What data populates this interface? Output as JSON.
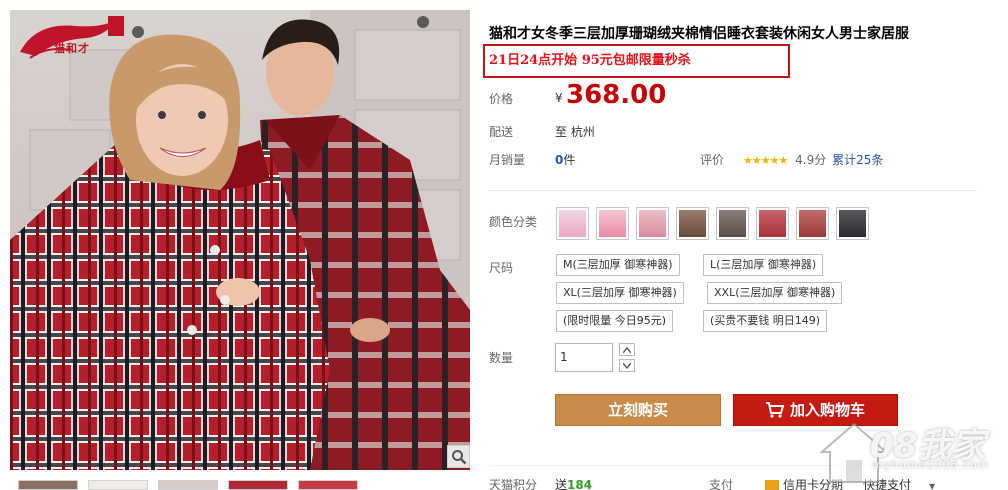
{
  "brand": {
    "logo_text": "猫和才"
  },
  "product": {
    "title": "猫和才女冬季三层加厚珊瑚绒夹棉情侣睡衣套装休闲女人男士家居服",
    "promo": "21日24点开始 95元包邮限量秒杀"
  },
  "price": {
    "label": "价格",
    "currency": "¥",
    "value": "368.00"
  },
  "shipping": {
    "label": "配送",
    "value": "至 杭州"
  },
  "monthly_sales": {
    "label": "月销量",
    "count": "0",
    "unit": "件"
  },
  "rating": {
    "label": "评价",
    "stars": "★★★★★",
    "score": "4.9分",
    "reviews": "累计25条"
  },
  "color": {
    "label": "颜色分类",
    "swatches": [
      {
        "name": "pink-floral",
        "color": "#e9a9c4"
      },
      {
        "name": "pink-solid",
        "color": "#e98aa3"
      },
      {
        "name": "pink-couple",
        "color": "#d98a9a"
      },
      {
        "name": "brown-plaid",
        "color": "#6b4a3c"
      },
      {
        "name": "dark-check",
        "color": "#5a4d4a"
      },
      {
        "name": "red-plaid",
        "color": "#a8313c"
      },
      {
        "name": "red-check",
        "color": "#9a3a3a"
      },
      {
        "name": "black-men",
        "color": "#2b2b2e"
      }
    ]
  },
  "size": {
    "label": "尺码",
    "options": [
      "M(三层加厚 御寒神器)",
      "L(三层加厚 御寒神器)",
      "XL(三层加厚 御寒神器)",
      "XXL(三层加厚 御寒神器)",
      "(限时限量 今日95元)",
      "(买贵不要钱 明日149)"
    ]
  },
  "quantity": {
    "label": "数量",
    "value": "1"
  },
  "actions": {
    "buy_now": "立刻购买",
    "add_to_cart": "加入购物车"
  },
  "bottom": {
    "points_label": "天猫积分",
    "points_prefix": "送",
    "points_value": "184",
    "pay_label": "支付",
    "installment": "信用卡分期",
    "express_pay": "快捷支付"
  },
  "watermark": {
    "text": "08我家",
    "url": "myhome2008.com"
  },
  "colors": {
    "price": "#c40000",
    "promo": "#e4141b",
    "buy": "#c98b49",
    "cart": "#c41a12"
  }
}
